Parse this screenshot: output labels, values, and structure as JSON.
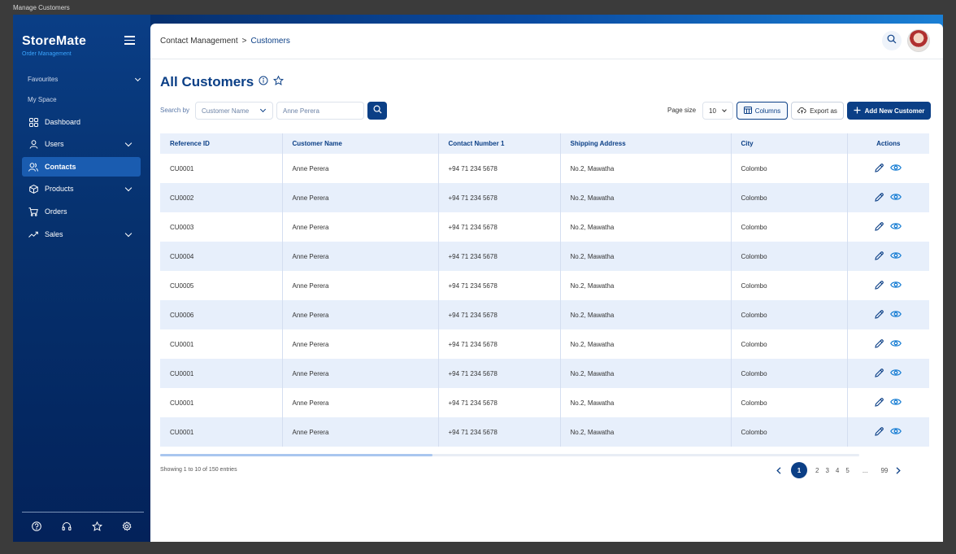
{
  "window_title": "Manage Customers",
  "brand": {
    "name": "StoreMate",
    "subtitle": "Order Management"
  },
  "sidebar": {
    "section_favourites": "Favourites",
    "section_myspace": "My Space",
    "items": [
      {
        "label": "Dashboard",
        "icon": "grid-icon"
      },
      {
        "label": "Users",
        "icon": "user-icon"
      },
      {
        "label": "Contacts",
        "icon": "contacts-icon"
      },
      {
        "label": "Products",
        "icon": "box-icon"
      },
      {
        "label": "Orders",
        "icon": "cart-icon"
      },
      {
        "label": "Sales",
        "icon": "trend-icon"
      }
    ],
    "active": "Contacts"
  },
  "breadcrumb": {
    "parent": "Contact Management",
    "separator": ">",
    "current": "Customers"
  },
  "page": {
    "title": "All Customers"
  },
  "filters": {
    "search_by": "Search by",
    "field_select": "Customer Name",
    "search_placeholder": "Anne Perera",
    "page_size_label": "Page size",
    "page_size": "10",
    "columns_label": "Columns",
    "export_label": "Export as",
    "add_label": "Add New Customer"
  },
  "table": {
    "columns": [
      "Reference ID",
      "Customer Name",
      "Contact Number 1",
      "Shipping Address",
      "City",
      "Actions"
    ],
    "rows": [
      [
        "CU0001",
        "Anne Perera",
        "+94 71 234 5678",
        "No.2, Mawatha",
        "Colombo"
      ],
      [
        "CU0002",
        "Anne Perera",
        "+94 71 234 5678",
        "No.2, Mawatha",
        "Colombo"
      ],
      [
        "CU0003",
        "Anne Perera",
        "+94 71 234 5678",
        "No.2, Mawatha",
        "Colombo"
      ],
      [
        "CU0004",
        "Anne Perera",
        "+94 71 234 5678",
        "No.2, Mawatha",
        "Colombo"
      ],
      [
        "CU0005",
        "Anne Perera",
        "+94 71 234 5678",
        "No.2, Mawatha",
        "Colombo"
      ],
      [
        "CU0006",
        "Anne Perera",
        "+94 71 234 5678",
        "No.2, Mawatha",
        "Colombo"
      ],
      [
        "CU0001",
        "Anne Perera",
        "+94 71 234 5678",
        "No.2, Mawatha",
        "Colombo"
      ],
      [
        "CU0001",
        "Anne Perera",
        "+94 71 234 5678",
        "No.2, Mawatha",
        "Colombo"
      ],
      [
        "CU0001",
        "Anne Perera",
        "+94 71 234 5678",
        "No.2, Mawatha",
        "Colombo"
      ],
      [
        "CU0001",
        "Anne Perera",
        "+94 71 234 5678",
        "No.2, Mawatha",
        "Colombo"
      ]
    ]
  },
  "scroll_progress": 0.39,
  "footer": {
    "showing": "Showing 1 to 10 of 150 entries",
    "pages": [
      "1",
      "2",
      "3",
      "4",
      "5"
    ],
    "ellipsis": "...",
    "last_page": "99",
    "current_page": "1"
  },
  "colors": {
    "primary": "#0b3f86",
    "row_alt": "#e7effb",
    "accent": "#3aa6ff"
  }
}
